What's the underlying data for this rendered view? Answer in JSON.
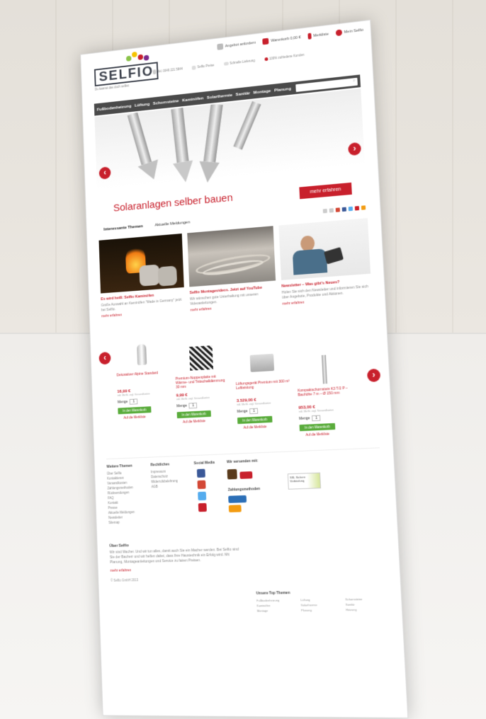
{
  "header": {
    "links": [
      "Angebot anfordern",
      "Warenkorb 0,00 €",
      "Merkliste",
      "Mein Selfio"
    ],
    "logo_text": "SELFIO",
    "logo_tagline": "Du kannst das doch selbst",
    "info": [
      "Tel. 0049 221 5844",
      "Selfio Preise",
      "Schnelle Lieferung",
      "100% zufriedene Kunden"
    ]
  },
  "nav": {
    "items": [
      "Fußbodenheizung",
      "Lüftung",
      "Schornsteine",
      "Kaminöfen",
      "Solarthermie",
      "Sanitär",
      "Montage",
      "Planung"
    ],
    "search_icon": "⌕"
  },
  "hero": {
    "caption": "Solaranlagen selber bauen",
    "cta": "mehr erfahren",
    "prev": "‹",
    "next": "›"
  },
  "tabs": [
    "Interessante Themen",
    "Aktuelle Meldungen"
  ],
  "topics": [
    {
      "title": "Es wird heiß: Selfio Kaminöfen",
      "text": "Große Auswahl an Kaminöfen \"Made in Germany\" jetzt bei Selfio.",
      "link": "mehr erfahren"
    },
    {
      "title": "Selfio Montagevideos. Jetzt auf YouTube",
      "text": "Wir wünschen gute Unterhaltung mit unseren Videoanleitungen.",
      "link": "mehr erfahren"
    },
    {
      "title": "Newsletter – Was gibt's Neues?",
      "text": "Holen Sie sich den Newsletter und informieren Sie sich über Angebote, Produkte und Aktionen.",
      "link": "mehr erfahren"
    }
  ],
  "products": [
    {
      "name": "Dekorativer Alpine Standard",
      "price": "16,99 €",
      "qty": "1",
      "cart": "In den Warenkorb",
      "wishlist": "Auf die Merkliste"
    },
    {
      "name": "Premium-Noppenplatte mit Wärme- und Trittschalldämmung 30 mm",
      "price": "9,99 €",
      "qty": "1",
      "cart": "In den Warenkorb",
      "wishlist": "Auf die Merkliste"
    },
    {
      "name": "Lüftungsgerät Premium mit 300 m³ Luftleistung",
      "price": "3.529,00 €",
      "qty": "1",
      "cart": "In den Warenkorb",
      "wishlist": "Auf die Merkliste"
    },
    {
      "name": "Kompaktschornstein K3 T/2 P – Bauhöhe 7 m – Ø 150 mm",
      "price": "953,00 €",
      "qty": "1",
      "cart": "In den Warenkorb",
      "wishlist": "Auf die Merkliste"
    }
  ],
  "product_meta": {
    "small": "inkl. MwSt. zzgl. Versandkosten",
    "qty_label": "Menge"
  },
  "footer": {
    "col1": {
      "title": "Weitere Themen",
      "items": [
        "Über Selfio",
        "Kontaktieren",
        "Versandkosten",
        "Zahlungsmethoden",
        "Rücksendungen",
        "FAQ",
        "Kontakt",
        "Presse",
        "Aktuelle Meldungen",
        "Newsletter",
        "Sitemap"
      ]
    },
    "col2": {
      "title": "Rechtliches",
      "items": [
        "Impressum",
        "Datenschutz",
        "Widerrufsbelehrung",
        "AGB"
      ]
    },
    "col3": {
      "title": "Social Media"
    },
    "col4": {
      "title": "Wir versenden mit:",
      "pay_title": "Zahlungsmethoden"
    },
    "ssl": "SSL Sichere Verbindung"
  },
  "about": {
    "title": "Über Selfio",
    "text": "Wir sind Macher. Und wir tun alles, damit auch Sie ein Macher werden. Bei Selfio sind Sie der Bauherr und wir helfen dabei, dass Ihre Haustechnik ein Erfolg wird. Mit Planung, Montageanleitungen und Service zu fairen Preisen.",
    "link": "mehr erfahren",
    "copyright": "© Selfio GmbH 2013"
  },
  "toptopics": {
    "title": "Unsere Top Themen",
    "items": [
      "Fußbodenheizung",
      "Lüftung",
      "Schornsteine",
      "Kaminöfen",
      "Solarthermie",
      "Sanitär",
      "Montage",
      "Planung",
      "Heizung"
    ]
  },
  "colors": {
    "brand_red": "#c8202c",
    "nav_bg": "#4a4a4a",
    "cart_green": "#5aac3c"
  }
}
